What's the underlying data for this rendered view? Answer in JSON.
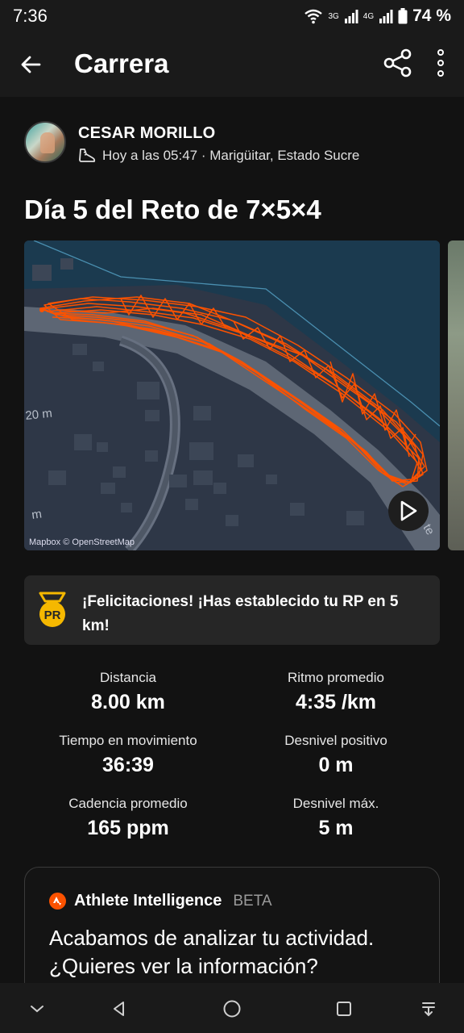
{
  "status_bar": {
    "time": "7:36",
    "net1": "3G",
    "net2": "4G",
    "battery": "74 %"
  },
  "app_bar": {
    "title": "Carrera"
  },
  "athlete": {
    "name": "CESAR MORILLO",
    "meta": "Hoy a las 05:47 · Marigüitar, Estado Sucre"
  },
  "activity": {
    "title": "Día 5 del Reto de 7×5×4"
  },
  "map": {
    "attribution": "Mapbox © OpenStreetMap",
    "label_scale_1": "20 m",
    "label_scale_2": "m",
    "label_street": "te",
    "route_color": "#fc5200"
  },
  "pr": {
    "badge": "PR",
    "message": "¡Felicitaciones! ¡Has establecido tu RP en 5 km!"
  },
  "stats": [
    {
      "label": "Distancia",
      "value": "8.00 km"
    },
    {
      "label": "Ritmo promedio",
      "value": "4:35 /km"
    },
    {
      "label": "Tiempo en movimiento",
      "value": "36:39"
    },
    {
      "label": "Desnivel positivo",
      "value": "0 m"
    },
    {
      "label": "Cadencia promedio",
      "value": "165 ppm"
    },
    {
      "label": "Desnivel máx.",
      "value": "5 m"
    }
  ],
  "ai": {
    "title": "Athlete Intelligence",
    "beta": "BETA",
    "body": "Acabamos de analizar tu actividad. ¿Quieres ver la información?"
  },
  "colors": {
    "accent": "#fc5200",
    "pr_gold": "#f5b800",
    "background": "#121212"
  },
  "icons": [
    "back-arrow-icon",
    "share-icon",
    "more-vertical-icon",
    "run-shoe-icon",
    "play-icon",
    "pr-medal-icon",
    "strava-icon"
  ]
}
